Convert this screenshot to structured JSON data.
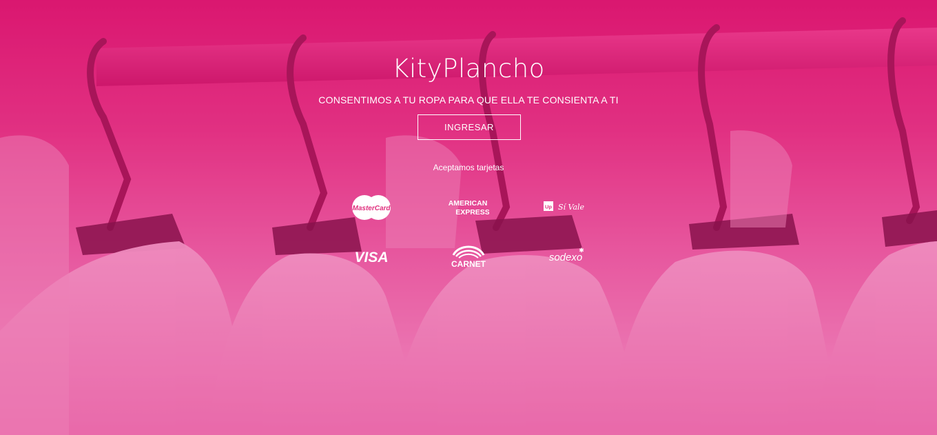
{
  "brand": {
    "title": "KityPlancho",
    "tagline": "CONSENTIMOS A TU ROPA PARA QUE ELLA TE CONSIENTA A TI"
  },
  "cta": {
    "label": "INGRESAR"
  },
  "cards": {
    "heading": "Aceptamos tarjetas",
    "logos": {
      "mastercard": "MasterCard",
      "amex_line1": "AMERICAN",
      "amex_line2": "EXPRESS",
      "sivale_badge": "Up",
      "sivale_text": "Sí Vale",
      "visa": "VISA",
      "carnet": "CARNET",
      "sodexo": "sodexo"
    }
  },
  "colors": {
    "brand_pink": "#d8136a",
    "light_pink": "#f5b8dc",
    "white": "#ffffff"
  }
}
